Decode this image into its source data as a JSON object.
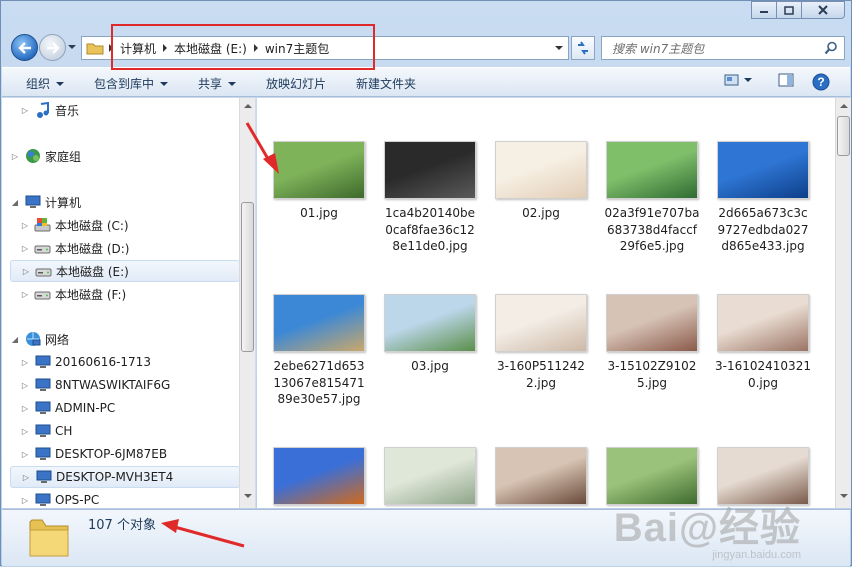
{
  "window": {
    "breadcrumb": [
      "计算机",
      "本地磁盘 (E:)",
      "win7主题包"
    ],
    "search_placeholder": "搜索 win7主题包"
  },
  "toolbar": {
    "items": [
      "组织",
      "包含到库中",
      "共享",
      "放映幻灯片",
      "新建文件夹"
    ]
  },
  "navpane": {
    "items": [
      {
        "label": "音乐",
        "icon": "music-icon"
      },
      {
        "label": "家庭组",
        "icon": "homegroup-icon"
      },
      {
        "label": "计算机",
        "icon": "computer-icon"
      },
      {
        "label": "本地磁盘 (C:)",
        "icon": "system-drive-icon"
      },
      {
        "label": "本地磁盘 (D:)",
        "icon": "drive-icon"
      },
      {
        "label": "本地磁盘 (E:)",
        "icon": "drive-icon",
        "selected": true
      },
      {
        "label": "本地磁盘 (F:)",
        "icon": "drive-icon"
      },
      {
        "label": "网络",
        "icon": "network-icon"
      },
      {
        "label": "20160616-1713",
        "icon": "pc-icon"
      },
      {
        "label": "8NTWASWIKTAIF6G",
        "icon": "pc-icon"
      },
      {
        "label": "ADMIN-PC",
        "icon": "pc-icon"
      },
      {
        "label": "CH",
        "icon": "pc-icon"
      },
      {
        "label": "DESKTOP-6JM87EB",
        "icon": "pc-icon"
      },
      {
        "label": "DESKTOP-MVH3ET4",
        "icon": "pc-icon",
        "hover": true
      },
      {
        "label": "OPS-PC",
        "icon": "pc-icon"
      }
    ]
  },
  "files": [
    {
      "name": "01.jpg",
      "thumb": [
        "#7fb35a",
        "#3e6a2c"
      ]
    },
    {
      "name": "1ca4b20140be0caf8fae36c128e11de0.jpg",
      "thumb": [
        "#2a2a2a",
        "#5a5a5a"
      ]
    },
    {
      "name": "02.jpg",
      "thumb": [
        "#f6efe3",
        "#e2cdb6"
      ]
    },
    {
      "name": "02a3f91e707ba683738d4faccf29f6e5.jpg",
      "thumb": [
        "#7fbf6a",
        "#2f6b33"
      ]
    },
    {
      "name": "2d665a673c3c9727edbda027d865e433.jpg",
      "thumb": [
        "#2f76d4",
        "#0d3f8a"
      ]
    },
    {
      "name": "2ebe6271d65313067e81547189e30e57.jpg",
      "thumb": [
        "#3c88d6",
        "#caa86a"
      ]
    },
    {
      "name": "03.jpg",
      "thumb": [
        "#bcd6ea",
        "#5a8f4a"
      ]
    },
    {
      "name": "3-160P5112422.jpg",
      "thumb": [
        "#f3ede6",
        "#cdb8a6"
      ]
    },
    {
      "name": "3-15102Z91025.jpg",
      "thumb": [
        "#d7c3b6",
        "#8a5a4a"
      ]
    },
    {
      "name": "3-161024103210.jpg",
      "thumb": [
        "#e9dcd2",
        "#9a7464"
      ]
    },
    {
      "name": "",
      "thumb": [
        "#3a6fd8",
        "#d06a1c"
      ]
    },
    {
      "name": "",
      "thumb": [
        "#dfe7d9",
        "#8fa58a"
      ]
    },
    {
      "name": "",
      "thumb": [
        "#d8c4b4",
        "#6a4a3a"
      ]
    },
    {
      "name": "",
      "thumb": [
        "#9bc27a",
        "#3f6b2e"
      ]
    },
    {
      "name": "",
      "thumb": [
        "#e6dbd2",
        "#7a5a4a"
      ]
    }
  ],
  "status": {
    "count": "107 个对象"
  },
  "watermark": {
    "main": "Bai@经验",
    "sub": "jingyan.baidu.com"
  },
  "colors": {
    "accent": "#2a6fc3",
    "highlight": "#e02a2a"
  }
}
